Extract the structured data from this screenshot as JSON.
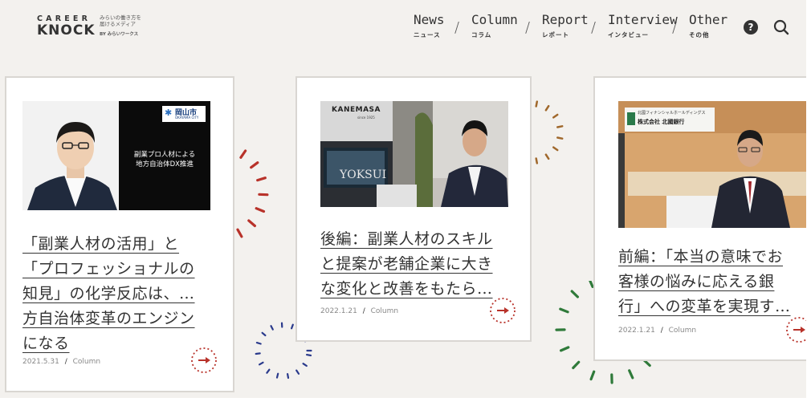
{
  "logo": {
    "line1": "CAREER",
    "line2": "KNOCK",
    "tagline1": "みらいの働き方を",
    "tagline2": "届けるメディア",
    "by": "BY みらいワークス"
  },
  "nav": [
    {
      "en": "News",
      "ja": "ニュース"
    },
    {
      "en": "Column",
      "ja": "コラム"
    },
    {
      "en": "Report",
      "ja": "レポート"
    },
    {
      "en": "Interview",
      "ja": "インタビュー"
    },
    {
      "en": "Other",
      "ja": "その他"
    }
  ],
  "nav_separator": "/",
  "header_icons": {
    "help": "?",
    "help_icon": "question-circle-icon",
    "search_icon": "search-icon"
  },
  "cards": [
    {
      "image": {
        "badge_text": "岡山市",
        "badge_sub": "OKAYAMA CITY",
        "caption_line1": "副業プロ人材による",
        "caption_line2": "地方自治体DX推進"
      },
      "title_lines": [
        "「副業人材の活用」と",
        "「プロフェッショナルの",
        "知見」の化学反応は、…",
        "方自治体変革のエンジン",
        "になる"
      ],
      "date": "2021.5.31",
      "category": "Column"
    },
    {
      "image": {
        "brand": "KANEMASA",
        "brand_sub": "since 1925",
        "screen_text": "YOKSUI"
      },
      "title_lines": [
        "後編：副業人材のスキル",
        "と提案が老舗企業に大き",
        "な変化と改善をもたら…"
      ],
      "date": "2022.1.21",
      "category": "Column"
    },
    {
      "image": {
        "sign_line1": "北國フィナンシャルホールディングス",
        "sign_line2": "株式会社 北國銀行"
      },
      "title_lines": [
        "前編：「本当の意味でお",
        "客様の悩みに応える銀",
        "行」への変革を実現す…"
      ],
      "date": "2022.1.21",
      "category": "Column"
    }
  ],
  "meta_separator": "/",
  "colors": {
    "background": "#f3f1ee",
    "card": "#ffffff",
    "accent_red": "#b8322a",
    "deco_brown": "#a0682c",
    "deco_navy": "#2a3a8c",
    "deco_green": "#2f7a3a"
  }
}
